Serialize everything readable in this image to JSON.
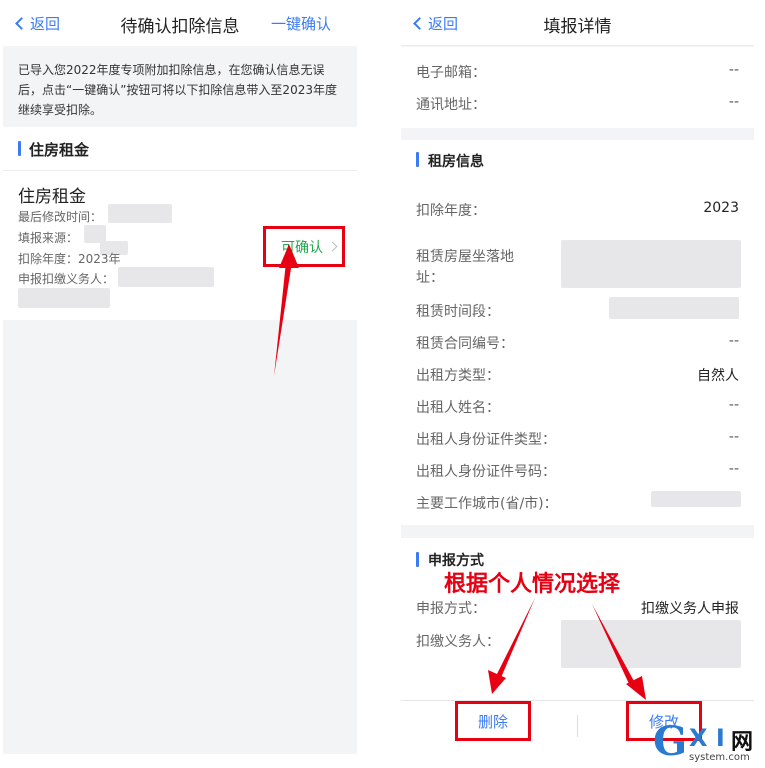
{
  "left": {
    "nav": {
      "back_label": "返回",
      "title": "待确认扣除信息",
      "action_label": "一键确认"
    },
    "notice": "已导入您2022年度专项附加扣除信息，在您确认信息无误后，点击“一键确认”按钮可将以下扣除信息带入至2023年度继续享受扣除。",
    "section_title": "住房租金",
    "card": {
      "name": "住房租金",
      "rows": [
        {
          "label": "最后修改时间："
        },
        {
          "label": "填报来源："
        },
        {
          "label": "扣除年度：2023年"
        },
        {
          "label": "申报扣缴义务人："
        }
      ],
      "confirm_label": "可确认"
    }
  },
  "right": {
    "nav": {
      "back_label": "返回",
      "title": "填报详情"
    },
    "contact": [
      {
        "label": "电子邮箱：",
        "value": "--"
      },
      {
        "label": "通讯地址：",
        "value": "--"
      }
    ],
    "rent_section_title": "租房信息",
    "rent": {
      "year_label": "扣除年度：",
      "year_value": "2023",
      "address_label": "租赁房屋坐落地址：",
      "period_label": "租赁时间段：",
      "contract_label": "租赁合同编号：",
      "contract_value": "--",
      "landlord_type_label": "出租方类型：",
      "landlord_type_value": "自然人",
      "landlord_name_label": "出租人姓名：",
      "landlord_name_value": "--",
      "id_type_label": "出租人身份证件类型：",
      "id_type_value": "--",
      "id_no_label": "出租人身份证件号码：",
      "id_no_value": "--",
      "city_label": "主要工作城市(省/市)："
    },
    "declare_section_title": "申报方式",
    "declare": {
      "method_label": "申报方式：",
      "method_value": "扣缴义务人申报",
      "agent_label": "扣缴义务人："
    },
    "buttons": {
      "delete_label": "删除",
      "edit_label": "修改"
    }
  },
  "annotation": "根据个人情况选择",
  "watermark": {
    "g": "G",
    "xi": "X I",
    "cn": "网",
    "domain": "system.com"
  },
  "colors": {
    "accent": "#3b7cf6",
    "highlight": "#e60012",
    "confirm_green": "#22a84d",
    "bg": "#f3f4f6"
  }
}
